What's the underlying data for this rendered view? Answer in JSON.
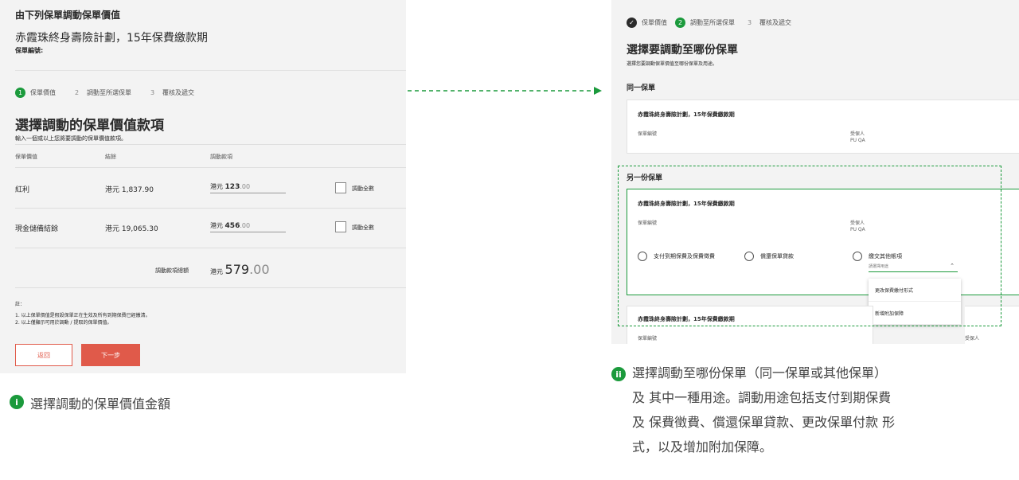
{
  "left": {
    "title": "由下列保單調動保單價值",
    "plan_name": "赤霞珠終身壽險計劃，15年保費繳款期",
    "policy_no_label": "保單編號:",
    "steps": [
      {
        "num": "1",
        "label": "保單價值"
      },
      {
        "num": "2",
        "label": "調動至所選保單"
      },
      {
        "num": "3",
        "label": "覆核及遞交"
      }
    ],
    "heading": "選擇調動的保單價值款項",
    "subheading": "輸入一個或以上您將要調動的保單價值款項。",
    "columns": [
      "保單價值",
      "結餘",
      "調動款項"
    ],
    "rows": [
      {
        "label": "紅利",
        "balance": "港元 1,837.90",
        "currency": "港元",
        "amount": "123",
        "decimals": ".00",
        "check_label": "調動全數"
      },
      {
        "label": "現金儲備結餘",
        "balance": "港元 19,065.30",
        "currency": "港元",
        "amount": "456",
        "decimals": ".00",
        "check_label": "調動全數"
      }
    ],
    "total_label": "調動款項總額",
    "total_currency": "港元",
    "total_amount": "579",
    "total_decimals": ".00",
    "notes_title": "註：",
    "notes": [
      "1. 以上保單價值是假設保單正在生效及所有到期保費已經繳清。",
      "2. 以上僅顯示可用於調動 / 提取的保單價值。"
    ],
    "back_button": "返回",
    "next_button": "下一步"
  },
  "caption_left": {
    "badge": "i",
    "text": "選擇調動的保單價值金額"
  },
  "right": {
    "steps": [
      {
        "num": "✓",
        "label": "保單價值"
      },
      {
        "num": "2",
        "label": "調動至所選保單"
      },
      {
        "num": "3",
        "label": "覆核及遞交"
      }
    ],
    "heading": "選擇要調動至哪份保單",
    "subheading": "選擇您要調動保單價值至哪份保單及用途。",
    "same_policy_title": "同一保單",
    "other_policy_title": "另一份保單",
    "card_plan_name": "赤霞珠終身壽險計劃，15年保費繳款期",
    "policy_no_label": "保單編號",
    "insured_label": "受保人",
    "insured_value": "PU QA",
    "radios": [
      "支付到期保費及保費徵費",
      "償還保單貸款",
      "繳交其他帳項"
    ],
    "dropdown_placeholder": "請選擇用途",
    "menu_items": [
      "更改保費繳付形式",
      "新增附加保障"
    ]
  },
  "caption_right": {
    "badge": "ii",
    "lines": [
      "選擇調動至哪份保單（同一保單或其他保單）",
      "及 其中一種用途。調動用途包括支付到期保費",
      "及 保費徵費、償還保單貸款、更改保單付款 形",
      "式，以及增加附加保障。"
    ]
  },
  "colors": {
    "green": "#1b9a3c",
    "red": "#e05a4a",
    "panel_bg": "#f3f3f3"
  }
}
